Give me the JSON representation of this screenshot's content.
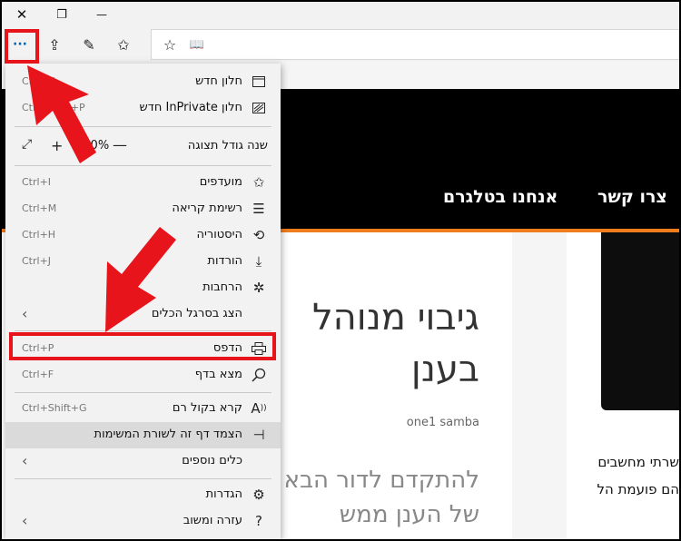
{
  "window": {
    "close": "✕",
    "restore": "❐",
    "minimize": "—"
  },
  "toolbar": {
    "more_icon": "···",
    "share_icon": "⇪",
    "notes_icon": "✎",
    "favorites_icon": "✩",
    "addr_star_icon": "☆",
    "reading_view_icon": "📖"
  },
  "menu": {
    "new_window": {
      "label": "חלון חדש",
      "shortcut": "Ctrl+N"
    },
    "inprivate": {
      "label": "חלון InPrivate חדש",
      "shortcut": "Ctrl+Shift+P"
    },
    "zoom": {
      "label": "שנה גודל תצוגה",
      "value": "120%",
      "expand": "⤢",
      "plus": "+",
      "minus": "—"
    },
    "favorites": {
      "label": "מועדפים",
      "shortcut": "Ctrl+I"
    },
    "reading_list": {
      "label": "רשימת קריאה",
      "shortcut": "Ctrl+M"
    },
    "history": {
      "label": "היסטוריה",
      "shortcut": "Ctrl+H"
    },
    "downloads": {
      "label": "הורדות",
      "shortcut": "Ctrl+J"
    },
    "extensions": {
      "label": "הרחבות"
    },
    "show_toolbar": {
      "label": "הצג בסרגל הכלים",
      "chevron": "‹"
    },
    "print": {
      "label": "הדפס",
      "shortcut": "Ctrl+P"
    },
    "find": {
      "label": "מצא בדף",
      "shortcut": "Ctrl+F"
    },
    "read_aloud": {
      "label": "קרא בקול רם",
      "shortcut": "Ctrl+Shift+G"
    },
    "pin_taskbar": {
      "label": "הצמד דף זה לשורת המשימות"
    },
    "more_tools": {
      "label": "כלים נוספים",
      "chevron": "‹"
    },
    "settings": {
      "label": "הגדרות"
    },
    "help": {
      "label": "עזרה ומשוב",
      "chevron": "‹"
    }
  },
  "page": {
    "nav_links": [
      "צרו קשר",
      "אנחנו בטלגרם"
    ],
    "article_title_line1": "גיבוי מנוהל",
    "article_title_line2": "בענן",
    "author": "one1 samba",
    "subtitle_line1": "להתקדם לדור הבא",
    "subtitle_line2": "של הענן ממש",
    "side_line1": "שרתי מחשבים",
    "side_line2": "הם פועמת הלב של"
  },
  "colors": {
    "highlight": "#e8141c",
    "arrow": "#e8141c",
    "nav_accent": "#ef7d1c"
  }
}
